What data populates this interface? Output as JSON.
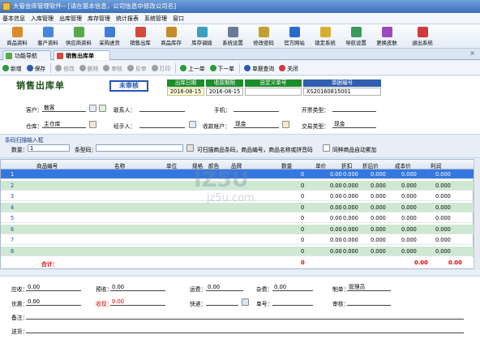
{
  "window": {
    "title": "大管会库管理软件-- [请在基本信息，公司信息中修改公司名]"
  },
  "menu": [
    "基本信息",
    "入库管理",
    "出库管理",
    "库存管理",
    "统计报表",
    "系统管理",
    "窗口"
  ],
  "toolbar": [
    {
      "label": "商品资料",
      "icon": "product-icon",
      "color": "#d98b2a"
    },
    {
      "label": "客户资料",
      "icon": "customer-icon",
      "color": "#4a86d8"
    },
    {
      "label": "供应商资料",
      "icon": "supplier-icon",
      "color": "#5aa84a"
    },
    {
      "label": "采购进货",
      "icon": "purchase-icon",
      "color": "#3f7ed6"
    },
    {
      "label": "销售出库",
      "icon": "sales-icon",
      "color": "#d44a3a"
    },
    {
      "label": "商品库存",
      "icon": "inventory-icon",
      "color": "#c58a2a"
    },
    {
      "label": "库存调拨",
      "icon": "transfer-icon",
      "color": "#3aa0c0"
    },
    {
      "label": "系统设置",
      "icon": "settings-icon",
      "color": "#6a7a9a"
    },
    {
      "label": "修改密码",
      "icon": "password-icon",
      "color": "#c0a030"
    },
    {
      "label": "官方网站",
      "icon": "website-icon",
      "color": "#2a6ad0"
    },
    {
      "label": "锁定系统",
      "icon": "lock-icon",
      "color": "#d8b030"
    },
    {
      "label": "导航设置",
      "icon": "navigation-icon",
      "color": "#3a9a5a"
    },
    {
      "label": "更换皮肤",
      "icon": "skin-icon",
      "color": "#9a4ac0"
    },
    {
      "label": "退出系统",
      "icon": "exit-icon",
      "color": "#d03a3a"
    }
  ],
  "tabs": {
    "nav": "功能导航",
    "active": "销售出库单",
    "close": "×"
  },
  "actions": [
    {
      "label": "新增",
      "icon": "add-icon",
      "color": "#2a9a3a",
      "disabled": false
    },
    {
      "label": "保存",
      "icon": "save-icon",
      "color": "#2a5ab0",
      "disabled": false
    },
    {
      "label": "修改",
      "icon": "edit-icon",
      "color": "#a0a0a0",
      "disabled": true
    },
    {
      "label": "删除",
      "icon": "delete-icon",
      "color": "#a0a0a0",
      "disabled": true
    },
    {
      "label": "审核",
      "icon": "audit-icon",
      "color": "#a0a0a0",
      "disabled": true
    },
    {
      "label": "反审",
      "icon": "unaudit-icon",
      "color": "#a0a0a0",
      "disabled": true
    },
    {
      "label": "打印",
      "icon": "print-icon",
      "color": "#a0a0a0",
      "disabled": true
    },
    {
      "label": "上一单",
      "icon": "prev-icon",
      "color": "#2a9a3a",
      "disabled": false
    },
    {
      "label": "下一单",
      "icon": "next-icon",
      "color": "#2a9a3a",
      "disabled": false
    },
    {
      "label": "单据查询",
      "icon": "query-icon",
      "color": "#2a5ab0",
      "disabled": false
    },
    {
      "label": "关闭",
      "icon": "close-icon",
      "color": "#d03a3a",
      "disabled": false
    }
  ],
  "header": {
    "doc_title": "销售出库单",
    "stamp": "未审核",
    "cols": {
      "out_date": {
        "label": "出库日期",
        "value": "2016-08-15"
      },
      "pay_deadline": {
        "label": "收款期限",
        "value": "2016-08-15"
      },
      "custom_no": {
        "label": "自定义单号",
        "value": ""
      },
      "doc_no": {
        "label": "单据编号",
        "value": "XS20160815001"
      }
    },
    "customer": {
      "label": "客户：",
      "value": "散客"
    },
    "contact": {
      "label": "联系人：",
      "value": ""
    },
    "phone": {
      "label": "手机：",
      "value": ""
    },
    "invoice_type": {
      "label": "开票类型：",
      "value": ""
    },
    "warehouse": {
      "label": "仓库：",
      "value": "主仓库"
    },
    "handler": {
      "label": "经手人：",
      "value": ""
    },
    "account": {
      "label": "收款帐户：",
      "value": "现金"
    },
    "trade_type": {
      "label": "交易类型：",
      "value": "现金"
    }
  },
  "barcode": {
    "legend": "条码扫描输入框",
    "qty_label": "数量：",
    "qty_value": "1",
    "code_label": "条型码：",
    "code_value": "",
    "hint": "可扫描商品条码，商品编号，商品名称或拼音码",
    "merge_label": "同种商品自动累加"
  },
  "grid": {
    "columns": [
      "商品编号",
      "名称",
      "单位",
      "规格",
      "颜色",
      "品牌",
      "数量",
      "单价",
      "折扣",
      "折后价",
      "成本价",
      "利润"
    ],
    "rows": [
      {
        "no": "1",
        "qty": "0",
        "price": "0.00",
        "discount": "0.000",
        "after": "0.000",
        "cost": "0.000",
        "profit": "0.000"
      },
      {
        "no": "2",
        "qty": "0",
        "price": "0.00",
        "discount": "0.000",
        "after": "0.000",
        "cost": "0.000",
        "profit": "0.000"
      },
      {
        "no": "3",
        "qty": "0",
        "price": "0.00",
        "discount": "0.000",
        "after": "0.000",
        "cost": "0.000",
        "profit": "0.000"
      },
      {
        "no": "4",
        "qty": "0",
        "price": "0.00",
        "discount": "0.000",
        "after": "0.000",
        "cost": "0.000",
        "profit": "0.000"
      },
      {
        "no": "5",
        "qty": "0",
        "price": "0.00",
        "discount": "0.000",
        "after": "0.000",
        "cost": "0.000",
        "profit": "0.000"
      },
      {
        "no": "6",
        "qty": "0",
        "price": "0.00",
        "discount": "0.000",
        "after": "0.000",
        "cost": "0.000",
        "profit": "0.000"
      },
      {
        "no": "7",
        "qty": "0",
        "price": "0.00",
        "discount": "0.000",
        "after": "0.000",
        "cost": "0.000",
        "profit": "0.000"
      },
      {
        "no": "8",
        "qty": "0",
        "price": "0.00",
        "discount": "0.000",
        "after": "0.000",
        "cost": "0.000",
        "profit": "0.000"
      }
    ],
    "total": {
      "label": "合计：",
      "qty": "0",
      "cost": "0.00",
      "profit": "0.00"
    }
  },
  "footer": {
    "receivable": {
      "label": "应收：",
      "value": "0.00"
    },
    "prepay": {
      "label": "预收：",
      "value": "0.00"
    },
    "freight": {
      "label": "运费：",
      "value": "0.00"
    },
    "misc": {
      "label": "杂费：",
      "value": "0.00"
    },
    "maker": {
      "label": "制单：",
      "value": "管理员"
    },
    "discount": {
      "label": "优惠：",
      "value": "0.00"
    },
    "received": {
      "label": "收现：",
      "value": "0.00"
    },
    "express": {
      "label": "快递：",
      "value": ""
    },
    "tracking": {
      "label": "单号：",
      "value": ""
    },
    "auditor": {
      "label": "审核：",
      "value": ""
    },
    "remark": {
      "label": "备注：",
      "value": ""
    },
    "ship_to": {
      "label": "送货：",
      "value": ""
    }
  },
  "watermark": "jz5u.com",
  "colors": {
    "title_green": "#1a4f1a",
    "stamp_blue": "#2456b0",
    "header_green": "#1c8d2a",
    "header_blue": "#2f5fb0",
    "row_alt": "#cfe8d2",
    "row_selected": "#3577e0",
    "total_red": "#d00000"
  }
}
